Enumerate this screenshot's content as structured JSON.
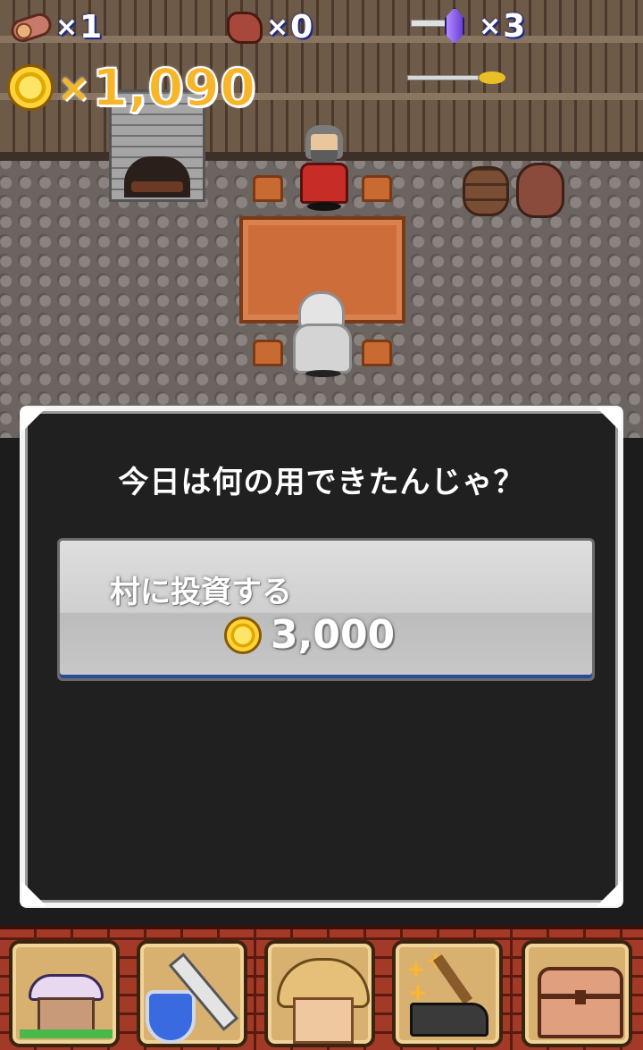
{
  "hud": {
    "wood": {
      "icon": "wood-log-icon",
      "multiplier": "×",
      "count": "1"
    },
    "ore": {
      "icon": "ore-icon",
      "multiplier": "×",
      "count": "0"
    },
    "crystal": {
      "icon": "crystal-sword-icon",
      "multiplier": "×",
      "count": "3"
    },
    "gold": {
      "icon": "gold-coin-icon",
      "multiplier": "×",
      "count": "1,090"
    }
  },
  "dialog": {
    "message": "今日は何の用できたんじゃ？",
    "option": {
      "label": "村に投資する",
      "cost_icon": "gold-coin-icon",
      "cost": "3,000"
    }
  },
  "menu": [
    {
      "name": "village",
      "icon": "house-icon"
    },
    {
      "name": "equipment",
      "icon": "sword-shield-icon"
    },
    {
      "name": "shop",
      "icon": "shopkeeper-icon"
    },
    {
      "name": "forge",
      "icon": "anvil-hammer-icon"
    },
    {
      "name": "storage",
      "icon": "treasure-chest-icon"
    }
  ],
  "colors": {
    "gold_text": "#f7b52a",
    "hud_outline": "#1a2a8c",
    "dialog_bg": "#202020",
    "dialog_border": "#f4f4f4",
    "button_bottom_accent": "#2a4a9a",
    "menu_brick": "#a33a28"
  }
}
